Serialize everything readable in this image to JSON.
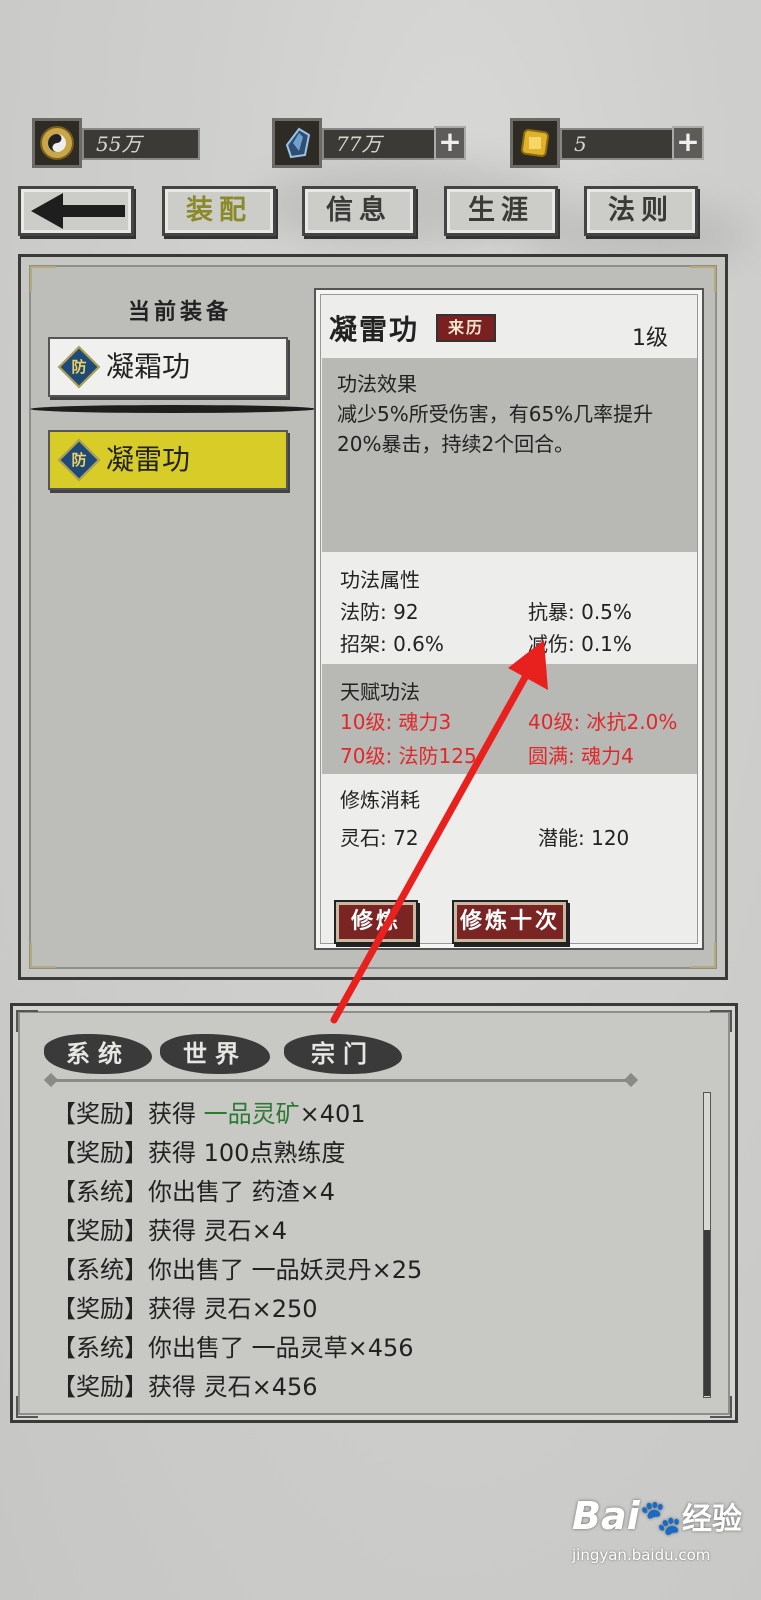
{
  "resources": [
    {
      "icon": "yin-yang-coin-icon",
      "value": "55万"
    },
    {
      "icon": "blue-crystal-icon",
      "value": "77万",
      "has_plus": true
    },
    {
      "icon": "gold-ingot-icon",
      "value": "5",
      "has_plus": true
    }
  ],
  "plus_label": "+",
  "nav": {
    "back_icon": "back-arrow-icon",
    "tabs": [
      "装配",
      "信息",
      "生涯",
      "法则"
    ],
    "active": "装配"
  },
  "equip": {
    "title": "当前装备",
    "badge": "防",
    "items": [
      {
        "name": "凝霜功",
        "selected": false
      },
      {
        "name": "凝雷功",
        "selected": true
      }
    ]
  },
  "detail": {
    "name": "凝雷功",
    "origin_label": "来历",
    "level": "1级",
    "effect_title": "功法效果",
    "effect_line1": "减少5%所受伤害，有65%几率提升",
    "effect_line2": "20%暴击，持续2个回合。",
    "attr_title": "功法属性",
    "attrs": [
      "法防: 92",
      "抗暴: 0.5%",
      "招架: 0.6%",
      "减伤: 0.1%"
    ],
    "talent_title": "天赋功法",
    "talents": [
      "10级: 魂力3",
      "40级: 冰抗2.0%",
      "70级: 法防125",
      "圆满: 魂力4"
    ],
    "cost_title": "修炼消耗",
    "costs": [
      "灵石: 72",
      "潜能: 120"
    ],
    "btn_train": "修炼",
    "btn_train10": "修炼十次"
  },
  "log": {
    "tabs": [
      "系统",
      "世界",
      "宗门"
    ],
    "lines": [
      {
        "prefix": "【奖励】获得 ",
        "highlight": "一品灵矿",
        "suffix": "×401"
      },
      {
        "prefix": "【奖励】获得 100点熟练度",
        "highlight": "",
        "suffix": ""
      },
      {
        "prefix": "【系统】你出售了 药渣×4",
        "highlight": "",
        "suffix": ""
      },
      {
        "prefix": "【奖励】获得 灵石×4",
        "highlight": "",
        "suffix": ""
      },
      {
        "prefix": "【系统】你出售了 一品妖灵丹×25",
        "highlight": "",
        "suffix": ""
      },
      {
        "prefix": "【奖励】获得 灵石×250",
        "highlight": "",
        "suffix": ""
      },
      {
        "prefix": "【系统】你出售了 一品灵草×456",
        "highlight": "",
        "suffix": ""
      },
      {
        "prefix": "【奖励】获得 灵石×456",
        "highlight": "",
        "suffix": ""
      }
    ]
  },
  "watermark": {
    "logo": "Bai",
    "logo2": "经验",
    "url": "jingyan.baidu.com"
  },
  "colors": {
    "talent_red": "#e0282a",
    "item_green": "#2e7a34",
    "selected_yellow": "#d8cc28",
    "origin_red": "#7a2020",
    "annotation_red": "#e8211f"
  }
}
